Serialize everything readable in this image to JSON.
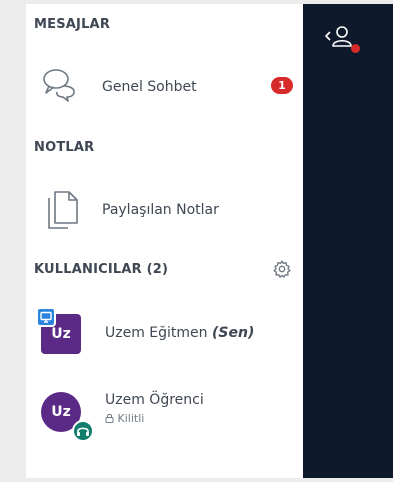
{
  "messages": {
    "section_title": "MESAJLAR",
    "public_chat": {
      "label": "Genel Sohbet",
      "unread": "1",
      "icon": "chat-bubbles-icon"
    }
  },
  "notes": {
    "section_title": "NOTLAR",
    "shared_notes": {
      "label": "Paylaşılan Notlar",
      "icon": "documents-icon"
    }
  },
  "users": {
    "section_title": "KULLANICILAR (2)",
    "settings_icon": "gear-icon",
    "list": [
      {
        "initials": "Uz",
        "name": "Uzem Eğitmen",
        "self_tag": "(Sen)",
        "role_icon": "presenter-icon"
      },
      {
        "initials": "Uz",
        "name": "Uzem Öğrenci",
        "status": "Kilitli",
        "role_icon": "headset-icon"
      }
    ]
  },
  "right_panel": {
    "toggle_icon": "user-list-toggle-icon"
  },
  "colors": {
    "dark_panel": "#0e1a2b",
    "badge": "#d72a2a",
    "avatar": "#5b2a86",
    "presenter": "#2a84e0",
    "voice": "#127e6e"
  }
}
